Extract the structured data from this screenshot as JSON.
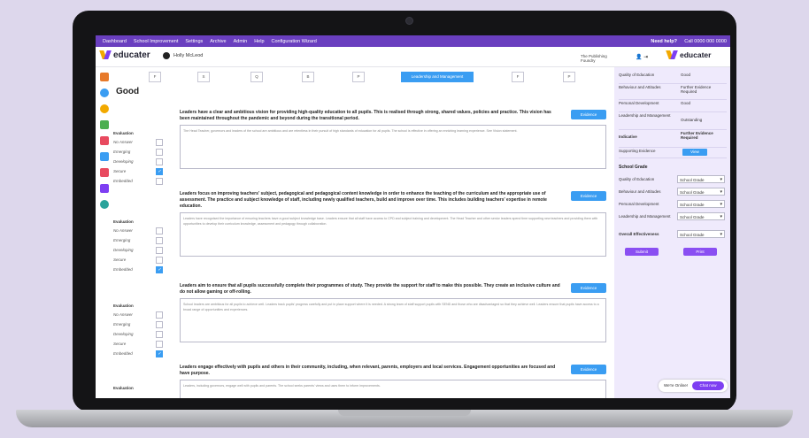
{
  "nav": {
    "items": [
      "Dashboard",
      "School Improvement",
      "Settings",
      "Archive",
      "Admin",
      "Help",
      "Configuration Wizard"
    ],
    "help": "Need help?",
    "call": "Call 0000 000 0000"
  },
  "header": {
    "logo": "educater",
    "user": "Holly McLeod",
    "school": "The Publishing Foundry"
  },
  "right_header": {
    "logo": "educater",
    "icons": "👤 ⇥"
  },
  "grade": "Good",
  "tabs": [
    "F",
    "S",
    "Q",
    "B",
    "P",
    "Leadership and Management",
    "F",
    "P"
  ],
  "evaluation": {
    "title": "Evaluation",
    "options": [
      "No Answer",
      "Emerging",
      "Developing",
      "Secure",
      "Embedded"
    ]
  },
  "sections": [
    {
      "statement": "Leaders have a clear and ambitious vision for providing high-quality education to all pupils. This is realised through strong, shared values, policies and practice. This vision has been maintained throughout the pandemic and beyond during the transitional period.",
      "text": "The Head Teacher, governors and leaders of the school are ambitious and are relentless in their pursuit of high standards of education for all pupils. The school is effective in offering an enriching learning experience. See Vision statement.",
      "evidence": "Evidence",
      "checked": 3
    },
    {
      "statement": "Leaders focus on improving teachers' subject, pedagogical and pedagogical content knowledge in order to enhance the teaching of the curriculum and the appropriate use of assessment. The practice and subject knowledge of staff, including newly qualified teachers, build and improve over time. This includes building teachers' expertise in remote education.",
      "text": "Leaders have recognised the importance of ensuring teachers have a good subject knowledge base. Leaders ensure that all staff have access to CPD and subject training and development. The Head Teacher and other senior leaders spend time supporting new teachers and providing them with opportunities to develop their curriculum knowledge, assessment and pedagogy through collaboration.",
      "evidence": "Evidence",
      "checked": 4
    },
    {
      "statement": "Leaders aim to ensure that all pupils successfully complete their programmes of study. They provide the support for staff to make this possible. They create an inclusive culture and do not allow gaming or off-rolling.",
      "text": "School leaders are ambitious for all pupils to achieve well. Leaders track pupils' progress carefully and put in place support where it is needed. A strong team of staff support pupils with SEND and those who are disadvantaged so that they achieve well. Leaders ensure that pupils have access to a broad range of opportunities and experiences.",
      "evidence": "Evidence",
      "checked": 4
    },
    {
      "statement": "Leaders engage effectively with pupils and others in their community, including, when relevant, parents, employers and local services. Engagement opportunities are focused and have purpose.",
      "text": "Leaders, including governors, engage well with pupils and parents. The school seeks parents' views and uses them to inform improvements.",
      "evidence": "Evidence",
      "checked": -1
    }
  ],
  "right_panel": {
    "rows": [
      {
        "label": "Quality of Education",
        "value": "Good",
        "bold": false
      },
      {
        "label": "Behaviour and Attitudes",
        "value": "Further Evidence Required",
        "bold": false
      },
      {
        "label": "Personal Development",
        "value": "Good",
        "bold": false
      },
      {
        "label": "Leadership and Management",
        "value": "Outstanding",
        "bold": false
      },
      {
        "label": "Indicative",
        "value": "Further Evidence Required",
        "bold": true
      },
      {
        "label": "Supporting Evidence",
        "value": "",
        "bold": false
      }
    ],
    "view_button": "View",
    "school_grade_title": "School Grade",
    "school_grades": [
      {
        "label": "Quality of Education",
        "value": "School Grade"
      },
      {
        "label": "Behaviour and Attitudes",
        "value": "School Grade"
      },
      {
        "label": "Personal Development",
        "value": "School Grade"
      },
      {
        "label": "Leadership and Management",
        "value": "School Grade"
      },
      {
        "label": "Overall Effectiveness",
        "value": "School Grade"
      }
    ],
    "submit_button": "Submit",
    "print_button": "Print"
  },
  "chat": {
    "text": "We're Online!",
    "button": "Chat now"
  },
  "colors": {
    "accent": "#7e3ff2",
    "blue": "#3a9df2",
    "nav": "#6a3fbf"
  }
}
